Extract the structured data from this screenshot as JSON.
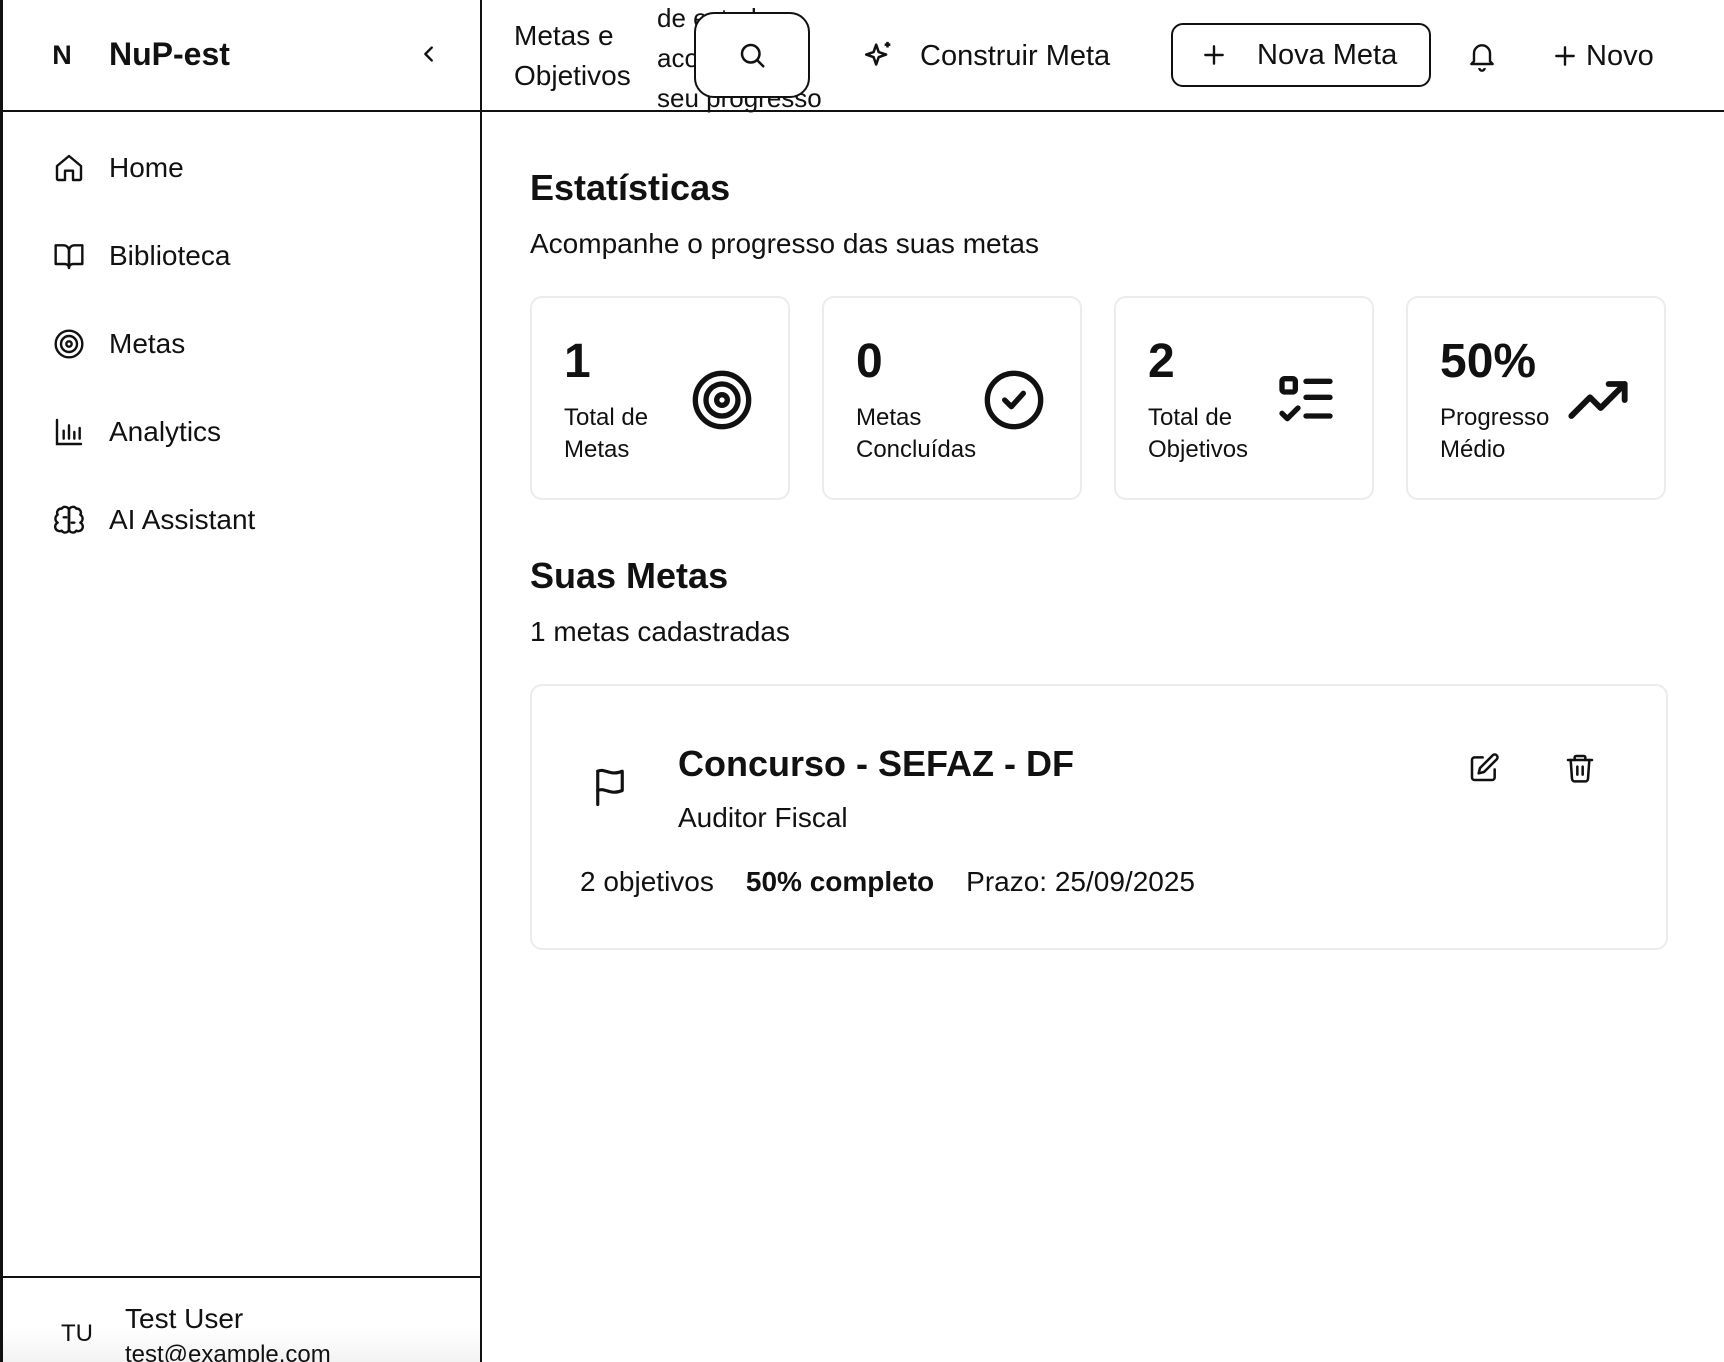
{
  "sidebar": {
    "logo": "N",
    "brand": "NuP-est",
    "items": [
      {
        "label": "Home",
        "icon": "home-icon"
      },
      {
        "label": "Biblioteca",
        "icon": "book-open-icon"
      },
      {
        "label": "Metas",
        "icon": "target-icon"
      },
      {
        "label": "Analytics",
        "icon": "bar-chart-icon"
      },
      {
        "label": "AI Assistant",
        "icon": "brain-icon"
      }
    ],
    "user": {
      "initials": "TU",
      "name": "Test User",
      "email": "test@example.com"
    }
  },
  "topbar": {
    "title": "Metas e Objetivos",
    "subtitle": "de estudo e acompanhe seu progresso",
    "construir_label": "Construir Meta",
    "nova_meta_label": "Nova Meta",
    "novo_label": "Novo"
  },
  "stats": {
    "title": "Estatísticas",
    "subtitle": "Acompanhe o progresso das suas metas",
    "cards": [
      {
        "value": "1",
        "label": "Total de Metas",
        "icon": "target-icon"
      },
      {
        "value": "0",
        "label": "Metas Concluídas",
        "icon": "check-circle-icon"
      },
      {
        "value": "2",
        "label": "Total de Objetivos",
        "icon": "list-checks-icon"
      },
      {
        "value": "50%",
        "label": "Progresso Médio",
        "icon": "trending-up-icon"
      }
    ]
  },
  "goals": {
    "title": "Suas Metas",
    "subtitle": "1 metas cadastradas",
    "items": [
      {
        "title": "Concurso - SEFAZ - DF",
        "subtitle": "Auditor Fiscal",
        "objectives": "2 objetivos",
        "progress": "50% completo",
        "deadline": "Prazo: 25/09/2025"
      }
    ]
  }
}
